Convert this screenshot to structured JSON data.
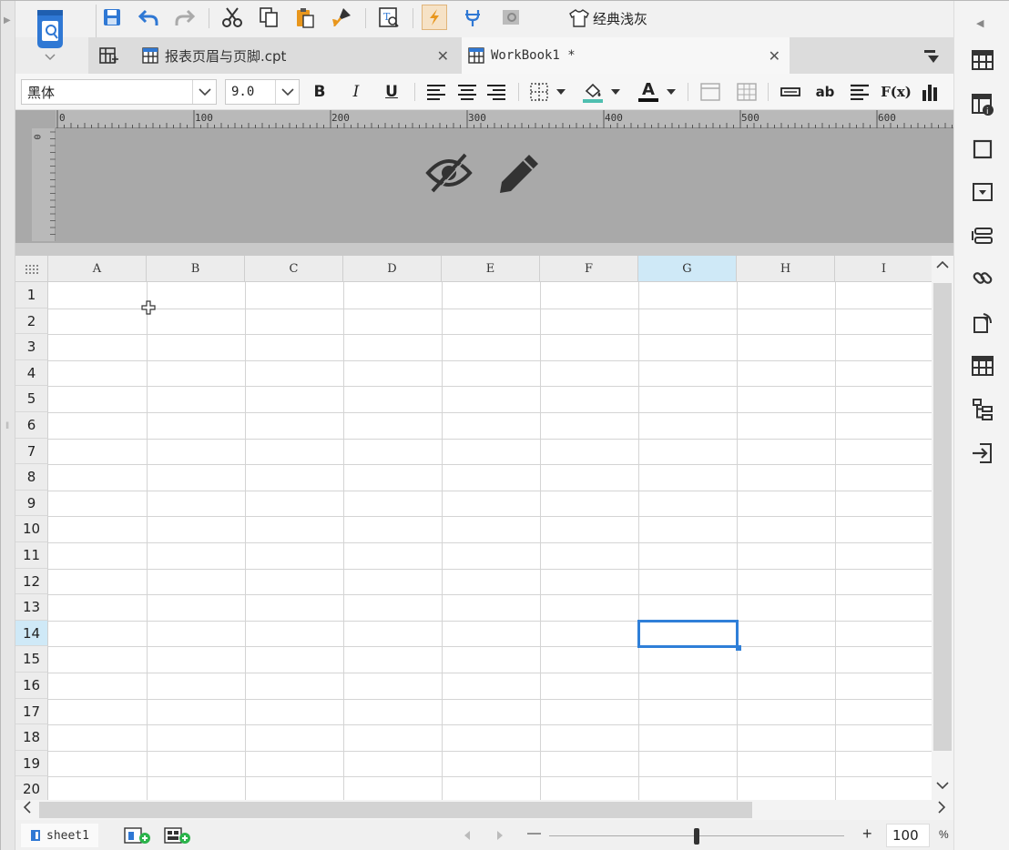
{
  "toolbar": {
    "theme_label": "经典浅灰",
    "icons": [
      "save-icon",
      "undo-icon",
      "redo-icon",
      "cut-icon",
      "copy-icon",
      "paste-icon",
      "format-painter-icon",
      "find-icon",
      "plugin-icon",
      "connect-icon",
      "preview-icon",
      "theme-icon"
    ]
  },
  "tabs": [
    {
      "label": "报表页眉与页脚.cpt",
      "active": false
    },
    {
      "label": "WorkBook1 *",
      "active": true
    }
  ],
  "format_bar": {
    "font_family": "黑体",
    "font_size": "9.0",
    "bold": "B",
    "italic": "I",
    "underline": "U",
    "text_color_glyph": "A",
    "text_label": "ab",
    "formula_label": "F(x)"
  },
  "ruler": {
    "labels": [
      "0",
      "100",
      "200",
      "300",
      "400",
      "500",
      "600"
    ],
    "vertical_label": "0"
  },
  "grid": {
    "columns": [
      "A",
      "B",
      "C",
      "D",
      "E",
      "F",
      "G",
      "H",
      "I"
    ],
    "rows": [
      "1",
      "2",
      "3",
      "4",
      "5",
      "6",
      "7",
      "8",
      "9",
      "10",
      "11",
      "12",
      "13",
      "14",
      "15",
      "16",
      "17",
      "18",
      "19",
      "20"
    ],
    "selected_cell": "G14",
    "selected_column": "G",
    "selected_row": "14"
  },
  "status": {
    "sheet_name": "sheet1",
    "zoom_value": "100",
    "zoom_unit": "%",
    "zoom_level": 100,
    "zoom_minus": "—",
    "zoom_plus": "+"
  },
  "colors": {
    "accent": "#2f7fd8",
    "header_bg": "#a9a9a9",
    "selected_header": "#cfe9f7",
    "icon_blue": "#2f6fb5",
    "icon_orange": "#e8961c"
  }
}
